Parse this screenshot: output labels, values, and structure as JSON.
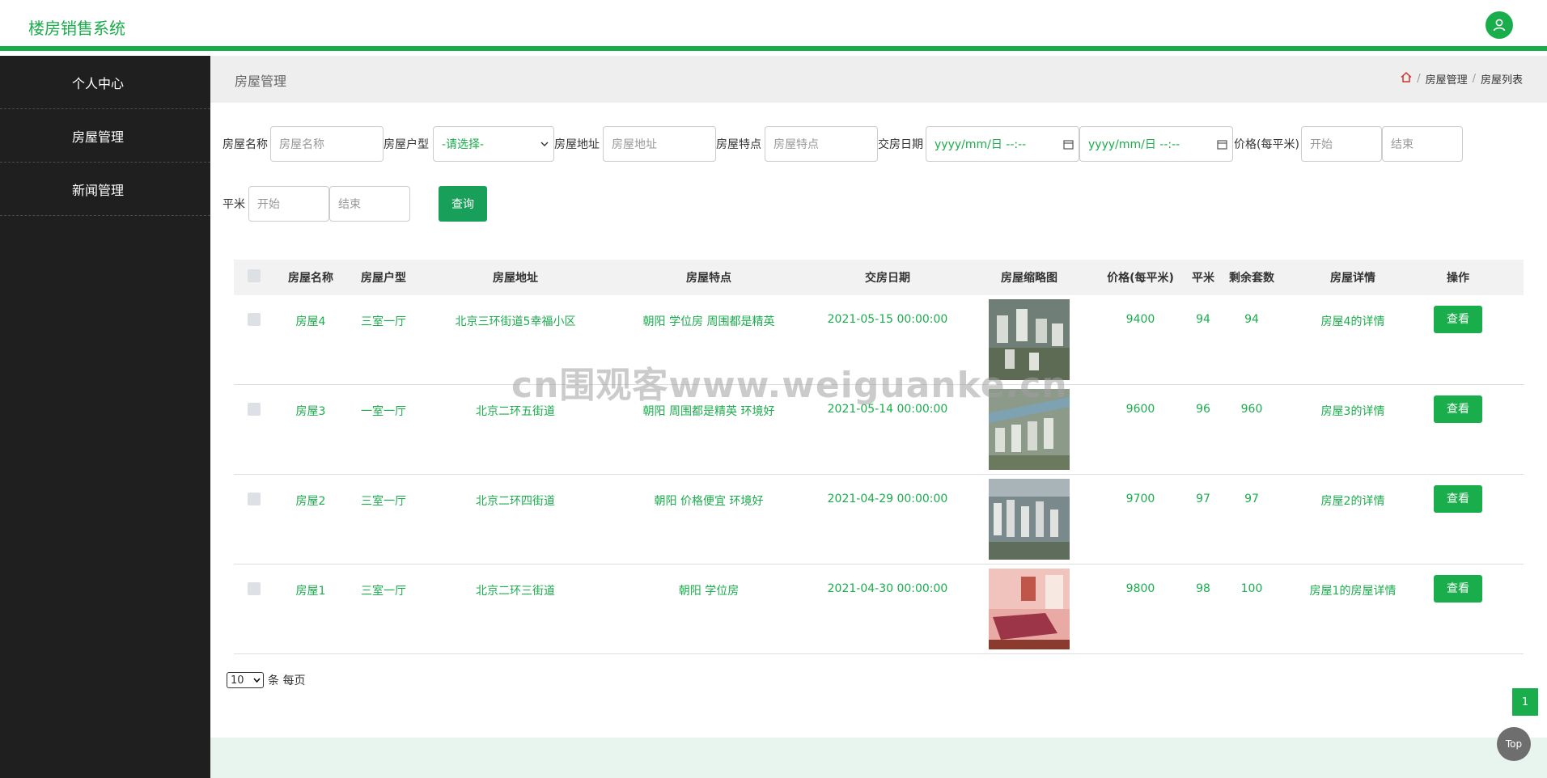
{
  "app": {
    "title": "楼房销售系统"
  },
  "sidebar": {
    "items": [
      {
        "label": "个人中心"
      },
      {
        "label": "房屋管理"
      },
      {
        "label": "新闻管理"
      }
    ]
  },
  "header": {
    "title": "房屋管理",
    "breadcrumb": [
      "房屋管理",
      "房屋列表"
    ],
    "separator": "/"
  },
  "filters": {
    "name": {
      "label": "房屋名称",
      "placeholder": "房屋名称"
    },
    "type": {
      "label": "房屋户型",
      "value": "-请选择-"
    },
    "address": {
      "label": "房屋地址",
      "placeholder": "房屋地址"
    },
    "feature": {
      "label": "房屋特点",
      "placeholder": "房屋特点"
    },
    "date": {
      "label": "交房日期",
      "start_placeholder": "yyyy/mm/日 --:--",
      "end_placeholder": "yyyy/mm/日 --:--"
    },
    "price": {
      "label": "价格(每平米)",
      "start_placeholder": "开始",
      "end_placeholder": "结束"
    },
    "area": {
      "label": "平米",
      "start_placeholder": "开始",
      "end_placeholder": "结束"
    },
    "query_label": "查询"
  },
  "table": {
    "columns": [
      "房屋名称",
      "房屋户型",
      "房屋地址",
      "房屋特点",
      "交房日期",
      "房屋缩略图",
      "价格(每平米)",
      "平米",
      "剩余套数",
      "房屋详情",
      "操作"
    ],
    "rows": [
      {
        "name": "房屋4",
        "type": "三室一厅",
        "address": "北京三环街道5幸福小区",
        "feature": "朝阳 学位房 周围都是精英",
        "date": "2021-05-15 00:00:00",
        "thumb": "aerial-buildings",
        "price": "9400",
        "area": "94",
        "remaining": "94",
        "detail": "房屋4的详情",
        "action": "查看"
      },
      {
        "name": "房屋3",
        "type": "一室一厅",
        "address": "北京二环五街道",
        "feature": "朝阳 周围都是精英 环境好",
        "date": "2021-05-14 00:00:00",
        "thumb": "aerial-buildings-river",
        "price": "9600",
        "area": "96",
        "remaining": "960",
        "detail": "房屋3的详情",
        "action": "查看"
      },
      {
        "name": "房屋2",
        "type": "三室一厅",
        "address": "北京二环四街道",
        "feature": "朝阳 价格便宜 环境好",
        "date": "2021-04-29 00:00:00",
        "thumb": "aerial-buildings-city",
        "price": "9700",
        "area": "97",
        "remaining": "97",
        "detail": "房屋2的详情",
        "action": "查看"
      },
      {
        "name": "房屋1",
        "type": "三室一厅",
        "address": "北京二环三街道",
        "feature": "朝阳 学位房",
        "date": "2021-04-30 00:00:00",
        "thumb": "bedroom-interior",
        "price": "9800",
        "area": "98",
        "remaining": "100",
        "detail": "房屋1的房屋详情",
        "action": "查看"
      }
    ]
  },
  "pagination": {
    "page_size": "10",
    "per_page_label": "条 每页",
    "current_page": "1"
  },
  "top_button": "Top",
  "watermark": "cn围观客www.weiguanke.cn",
  "colors": {
    "accent": "#1aad4c",
    "sidebar": "#1f1f1f",
    "query": "#18a05a"
  }
}
